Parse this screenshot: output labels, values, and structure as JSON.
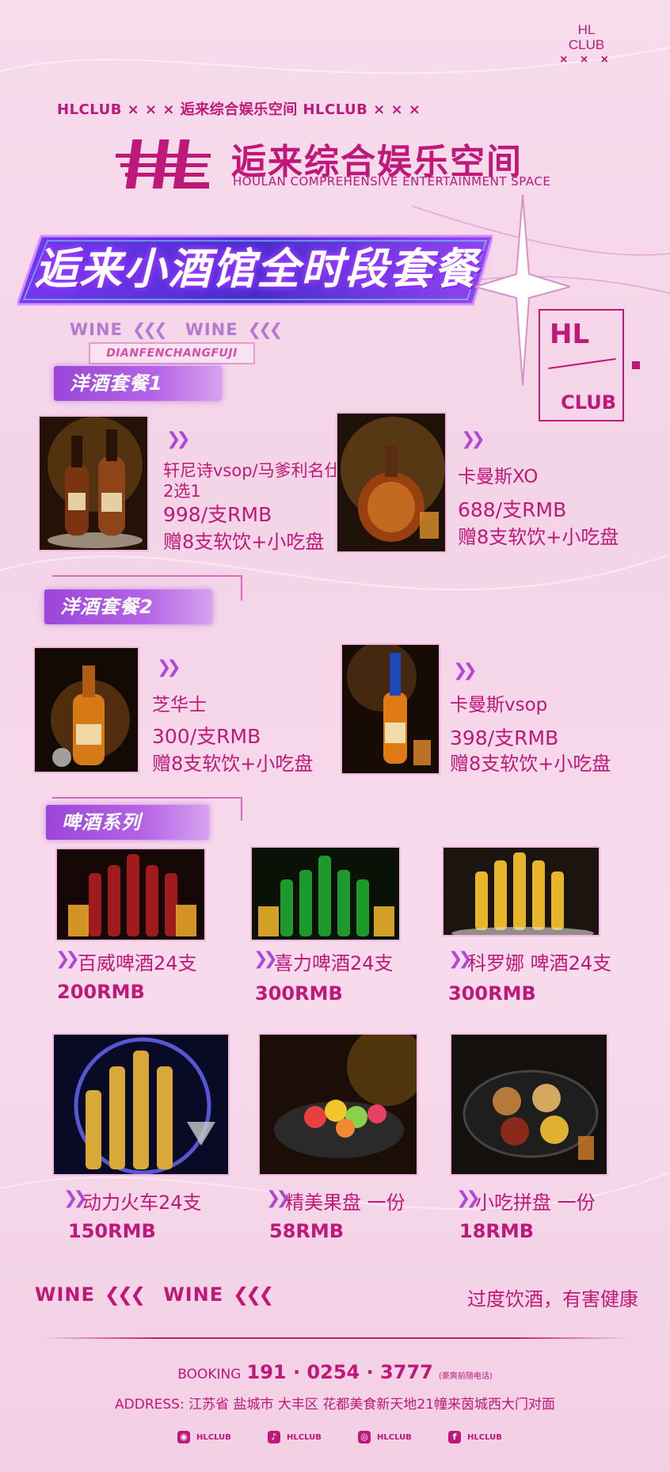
{
  "header": {
    "top_line": "HLCLUB × × ×  逅来综合娱乐空间  HLCLUB × × ×",
    "corner_logo_line1": "HL",
    "corner_logo_line2": "CLUB",
    "corner_logo_marks": "× × ×",
    "brand_cn": "逅来综合娱乐空间",
    "brand_en": "HOULAN COMPREHENSIVE ENTERTAINMENT SPACE",
    "hero_title": "逅来小酒馆全时段套餐",
    "wine_word": "WINE",
    "wine_arrows": "❮❮❮",
    "dian_tag": "DIANFENCHANGFUJI",
    "hl_box_top": "HL",
    "hl_box_bottom": "CLUB"
  },
  "sections": {
    "set1": {
      "title": "洋酒套餐1",
      "items": [
        {
          "name_line1": "轩尼诗vsop/马爹利名仕",
          "name_line2": "2选1",
          "price": "998/支RMB",
          "gift": "赠8支软饮+小吃盘"
        },
        {
          "name_line1": "卡曼斯XO",
          "name_line2": "",
          "price": "688/支RMB",
          "gift": "赠8支软饮+小吃盘"
        }
      ]
    },
    "set2": {
      "title": "洋酒套餐2",
      "items": [
        {
          "name_line1": "芝华士",
          "price": "300/支RMB",
          "gift": "赠8支软饮+小吃盘"
        },
        {
          "name_line1": "卡曼斯vsop",
          "price": "398/支RMB",
          "gift": "赠8支软饮+小吃盘"
        }
      ]
    },
    "beer": {
      "title": "啤酒系列",
      "items": [
        {
          "name": "百威啤酒24支",
          "price": "200RMB"
        },
        {
          "name": "喜力啤酒24支",
          "price": "300RMB"
        },
        {
          "name": "科罗娜 啤酒24支",
          "price": "300RMB"
        },
        {
          "name": "动力火车24支",
          "price": "150RMB"
        },
        {
          "name": "精美果盘 一份",
          "price": "58RMB"
        },
        {
          "name": "小吃拼盘 一份",
          "price": "18RMB"
        }
      ]
    }
  },
  "footer": {
    "warning": "过度饮酒，有害健康",
    "booking_label": "BOOKING",
    "booking_number": "191 · 0254 · 3777",
    "booking_note": "(豪爽前随电话)",
    "address": "ADDRESS: 江苏省  盐城市  大丰区  花都美食新天地21幢来茵城西大门对面",
    "social": [
      {
        "icon": "wechat-icon",
        "glyph": "◉",
        "label": "HLCLUB"
      },
      {
        "icon": "douyin-icon",
        "glyph": "♪",
        "label": "HLCLUB"
      },
      {
        "icon": "instagram-icon",
        "glyph": "◎",
        "label": "HLCLUB"
      },
      {
        "icon": "facebook-icon",
        "glyph": "f",
        "label": "HLCLUB"
      }
    ]
  },
  "colors": {
    "accent": "#c0187a",
    "purple": "#9b46d8",
    "background": "#f6d8ea"
  }
}
